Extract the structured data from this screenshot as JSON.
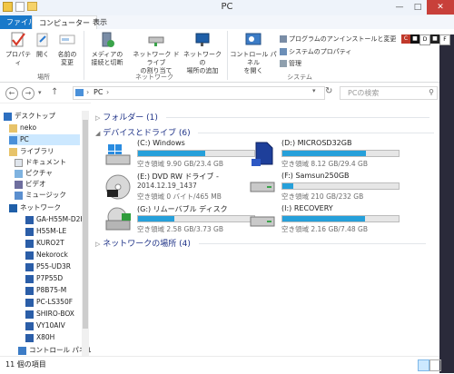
{
  "window": {
    "title": "PC"
  },
  "tabs": {
    "file": "ファイル",
    "computer": "コンピューター",
    "view": "表示"
  },
  "ribbon": {
    "properties": "プロパティ",
    "open": "開く",
    "rename_1": "名前の",
    "rename_2": "変更",
    "media_1": "メディアの",
    "media_2": "接続と切断",
    "map_drive_1": "ネットワーク ドライブ",
    "map_drive_2": "の割り当て",
    "add_location_1": "ネットワークの",
    "add_location_2": "場所の追加",
    "control_panel_1": "コントロール パネル",
    "control_panel_2": "を開く",
    "uninstall": "プログラムのアンインストールと変更",
    "system_properties": "システムのプロパティ",
    "manage": "管理",
    "group_location": "場所",
    "group_network": "ネットワーク",
    "group_system": "システム"
  },
  "address": {
    "path": "PC",
    "search_placeholder": "PCの検索"
  },
  "sidebar": {
    "items": [
      {
        "label": "デスクトップ"
      },
      {
        "label": "neko"
      },
      {
        "label": "PC"
      },
      {
        "label": "ライブラリ"
      },
      {
        "label": "ドキュメント"
      },
      {
        "label": "ピクチャ"
      },
      {
        "label": "ビデオ"
      },
      {
        "label": "ミュージック"
      },
      {
        "label": "ネットワーク"
      },
      {
        "label": "GA-H55M-D2H"
      },
      {
        "label": "H55M-LE"
      },
      {
        "label": "KURO2T"
      },
      {
        "label": "Nekorock"
      },
      {
        "label": "P55-UD3R"
      },
      {
        "label": "P7P55D"
      },
      {
        "label": "P8B75-M"
      },
      {
        "label": "PC-LS350F"
      },
      {
        "label": "SHIRO-BOX"
      },
      {
        "label": "VY10AIV"
      },
      {
        "label": "X80H"
      },
      {
        "label": "コントロール パネル"
      }
    ]
  },
  "sections": {
    "folders": "フォルダー (1)",
    "devices": "デバイスとドライブ (6)",
    "network": "ネットワークの場所 (4)"
  },
  "drives": [
    {
      "name": "(C:) Windows",
      "free": "空き領域 9.90 GB/23.4 GB",
      "used_pct": 58
    },
    {
      "name": "(D:) MICROSD32GB",
      "free": "空き領域 8.12 GB/29.4 GB",
      "used_pct": 72
    },
    {
      "name": "(E:) DVD RW ドライブ - ",
      "name2": "2014.12.19_1437",
      "free": "空き領域 0 バイト/465 MB"
    },
    {
      "name": "(F:) Samsun250GB",
      "free": "空き領域 210 GB/232 GB",
      "used_pct": 9
    },
    {
      "name": "(G:) リムーバブル ディスク",
      "free": "空き領域 2.58 GB/3.73 GB",
      "used_pct": 31
    },
    {
      "name": "(I:) RECOVERY",
      "free": "空き領域 2.16 GB/7.48 GB",
      "used_pct": 71
    }
  ],
  "status": {
    "count": "11 個の項目"
  },
  "colors": {
    "accent": "#1979ca",
    "bar": "#26a0da",
    "section": "#1e3287",
    "selected": "#cce8ff"
  }
}
